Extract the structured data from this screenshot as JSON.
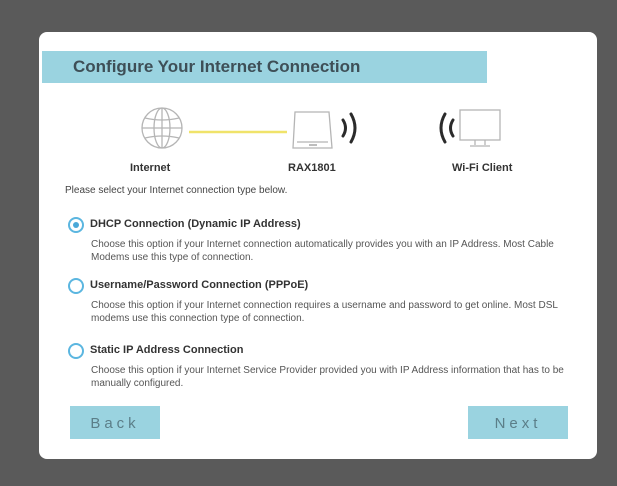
{
  "header": {
    "title": "Configure Your Internet Connection"
  },
  "diagram": {
    "internet_label": "Internet",
    "router_label": "RAX1801",
    "client_label": "Wi-Fi Client"
  },
  "instruction": "Please select your Internet connection type below.",
  "options": [
    {
      "label": "DHCP Connection (Dynamic IP Address)",
      "description": "Choose this option if your Internet connection automatically provides you with an IP Address. Most Cable Modems use this type of connection.",
      "selected": true
    },
    {
      "label": "Username/Password Connection (PPPoE)",
      "description": "Choose this option if your Internet connection requires a username and password to get online. Most DSL modems use this connection type of connection.",
      "selected": false
    },
    {
      "label": "Static IP Address Connection",
      "description": "Choose this option if your Internet Service Provider provided you with IP Address information that has to be manually configured.",
      "selected": false
    }
  ],
  "buttons": {
    "back": "Back",
    "next": "Next"
  },
  "colors": {
    "accent": "#9ad3e0",
    "radio": "#4aa8d8",
    "link_line": "#f0e36a"
  }
}
